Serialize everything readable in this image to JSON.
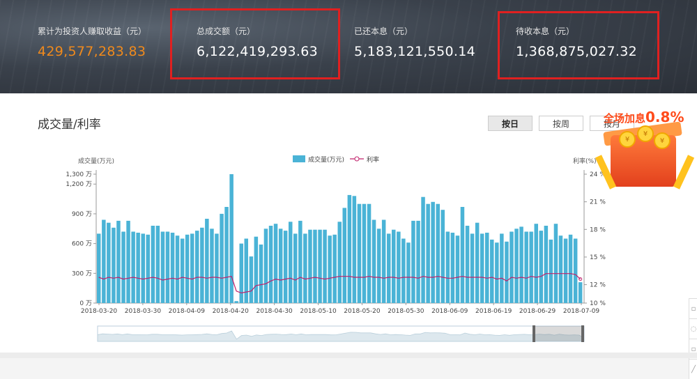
{
  "stats": [
    {
      "label": "累计为投资人赚取收益（元）",
      "value": "429,577,283.83"
    },
    {
      "label": "总成交额（元）",
      "value": "6,122,419,293.63"
    },
    {
      "label": "已还本息（元）",
      "value": "5,183,121,550.14"
    },
    {
      "label": "待收本息（元）",
      "value": "1,368,875,027.32"
    }
  ],
  "section_title": "成交量/利率",
  "period_buttons": [
    "按日",
    "按周",
    "按月"
  ],
  "active_period": "按日",
  "promo": {
    "text": "全场加息",
    "rate": "0.8%"
  },
  "chart_data": {
    "type": "bar",
    "ylabel_left": "成交量(万元)",
    "ylabel_right": "利率(%)",
    "legend": [
      "成交量(万元)",
      "利率"
    ],
    "left_ticks": [
      "0 万",
      "300 万",
      "600 万",
      "900 万",
      "1,200 万",
      "1,300 万"
    ],
    "right_ticks": [
      "10 %",
      "12 %",
      "15 %",
      "18 %",
      "21 %",
      "24 %"
    ],
    "x_ticks": [
      "2018-03-20",
      "2018-03-30",
      "2018-04-09",
      "2018-04-20",
      "2018-04-30",
      "2018-05-10",
      "2018-05-20",
      "2018-05-30",
      "2018-06-09",
      "2018-06-19",
      "2018-06-29",
      "2018-07-09"
    ],
    "ylim": [
      0,
      1300
    ],
    "y2lim": [
      10,
      24
    ],
    "colors": {
      "bar": "#4ab3d6",
      "line": "#c0206a"
    },
    "volume": [
      700,
      840,
      810,
      760,
      830,
      720,
      830,
      720,
      710,
      700,
      690,
      780,
      780,
      720,
      720,
      710,
      680,
      650,
      690,
      700,
      730,
      760,
      850,
      750,
      700,
      900,
      970,
      1300,
      20,
      600,
      650,
      470,
      670,
      590,
      750,
      780,
      800,
      750,
      730,
      820,
      700,
      830,
      700,
      740,
      740,
      740,
      740,
      680,
      690,
      820,
      960,
      1090,
      1080,
      1000,
      1000,
      1000,
      840,
      750,
      840,
      700,
      740,
      720,
      650,
      610,
      830,
      830,
      1070,
      1000,
      1020,
      1000,
      940,
      720,
      710,
      680,
      970,
      780,
      700,
      810,
      700,
      710,
      640,
      610,
      700,
      620,
      720,
      750,
      770,
      720,
      720,
      800,
      730,
      780,
      640,
      800,
      680,
      650,
      690,
      650,
      210
    ],
    "rate": [
      12.8,
      12.6,
      12.8,
      12.7,
      12.8,
      12.6,
      12.7,
      12.8,
      12.7,
      12.6,
      12.7,
      12.8,
      12.7,
      12.5,
      12.6,
      12.7,
      12.6,
      12.8,
      12.7,
      12.6,
      12.8,
      12.8,
      12.7,
      12.8,
      12.8,
      12.7,
      12.8,
      12.9,
      11.3,
      11.1,
      11.2,
      11.3,
      11.9,
      12.0,
      12.1,
      12.4,
      12.6,
      12.5,
      12.6,
      12.7,
      12.5,
      12.8,
      12.6,
      12.7,
      12.8,
      12.7,
      12.6,
      12.7,
      12.8,
      12.9,
      12.9,
      12.9,
      12.8,
      12.8,
      12.8,
      12.9,
      12.8,
      12.8,
      12.7,
      12.8,
      12.8,
      12.7,
      12.8,
      12.8,
      12.8,
      12.7,
      12.9,
      12.8,
      12.8,
      12.9,
      12.8,
      12.7,
      12.7,
      12.8,
      12.9,
      12.8,
      12.8,
      12.8,
      12.8,
      12.7,
      12.8,
      12.6,
      12.7,
      12.4,
      12.8,
      12.7,
      12.8,
      12.7,
      12.9,
      12.8,
      12.9,
      13.2,
      13.2,
      13.2,
      13.2,
      13.2,
      13.2,
      13.1,
      12.6,
      13.4
    ]
  }
}
